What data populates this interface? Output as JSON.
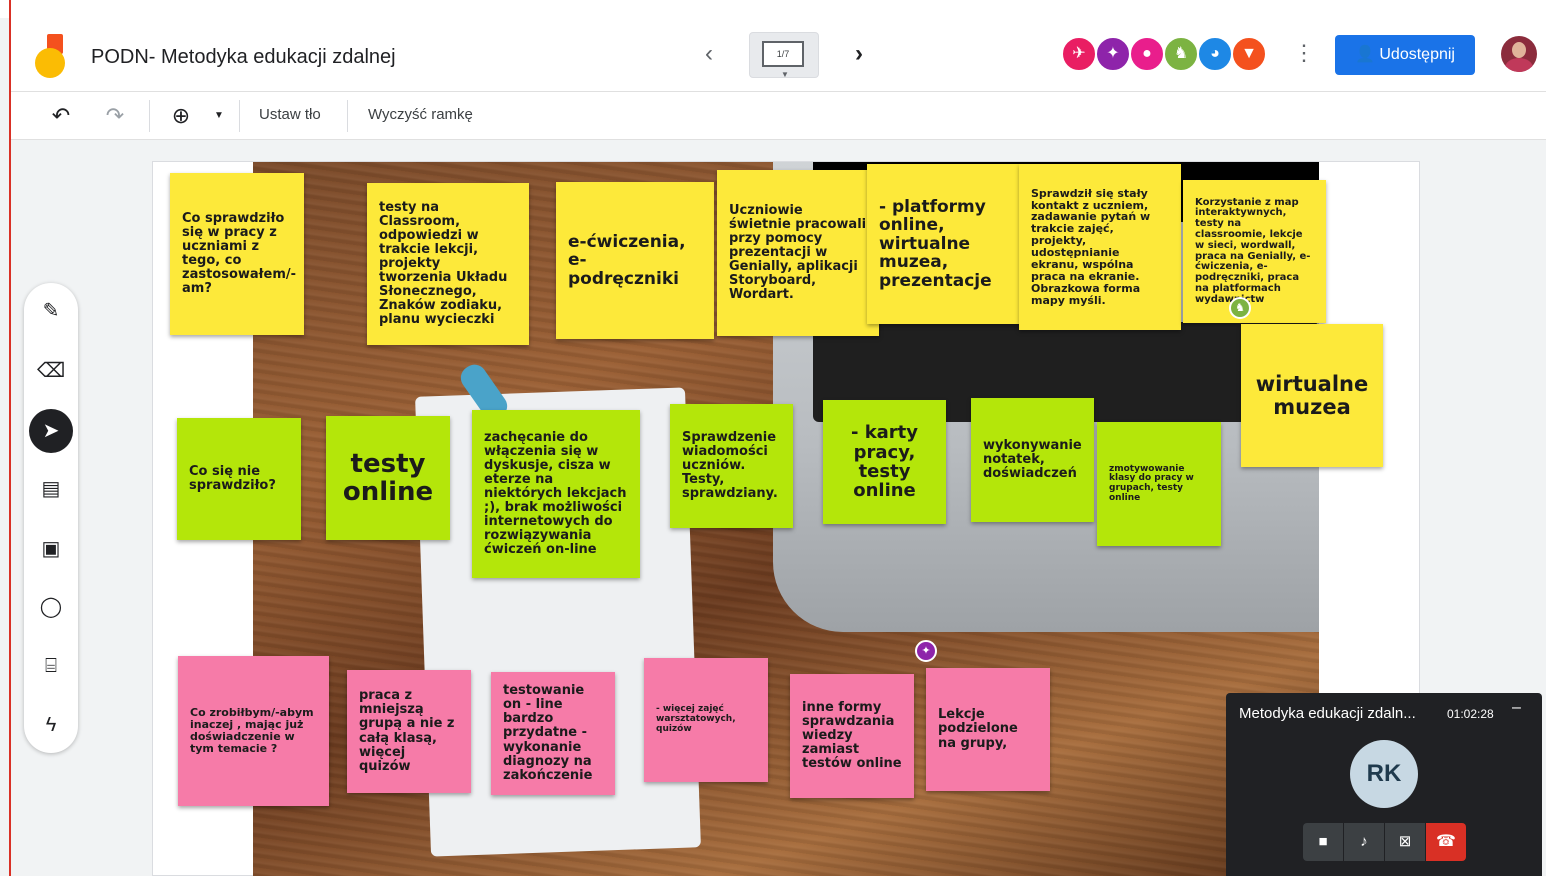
{
  "header": {
    "title": "PODN- Metodyka edukacji zdalnej",
    "frame_indicator": "1/7",
    "share_label": "Udostępnij"
  },
  "toolbar": {
    "set_background": "Ustaw tło",
    "clear_frame": "Wyczyść ramkę"
  },
  "notes": {
    "row1": [
      {
        "text": "Co sprawdziło się w pracy z uczniami z tego, co zastosowałem/-am?"
      },
      {
        "text": "testy na Classroom, odpowiedzi w trakcie lekcji, projekty tworzenia Układu Słonecznego, Znaków zodiaku, planu wycieczki"
      },
      {
        "text": "e-ćwiczenia, e- podręczniki"
      },
      {
        "text": "Uczniowie świetnie pracowali przy pomocy prezentacji w Genially, aplikacji Storyboard, Wordart."
      },
      {
        "text": "- platformy online, wirtualne muzea, prezentacje"
      },
      {
        "text": "Sprawdził się stały kontakt z uczniem, zadawanie pytań w trakcie zajęć, projekty, udostępnianie ekranu, wspólna praca na ekranie. Obrazkowa forma mapy myśli."
      },
      {
        "text": "Korzystanie z map interaktywnych, testy na classroomie, lekcje w sieci, wordwall, praca na Genially, e-ćwiczenia, e-podręczniki, praca na platformach wydawnictw"
      },
      {
        "text": "wirtualne muzea"
      }
    ],
    "row2": [
      {
        "text": "Co się nie sprawdziło?"
      },
      {
        "text": "testy online"
      },
      {
        "text": "zachęcanie do włączenia się w dyskusje, cisza w eterze na niektórych lekcjach ;), brak możliwości internetowych do rozwiązywania ćwiczeń on-line"
      },
      {
        "text": "Sprawdzenie wiadomości uczniów. Testy, sprawdziany."
      },
      {
        "text": "- karty pracy, testy online"
      },
      {
        "text": "wykonywanie notatek, doświadczeń"
      },
      {
        "text": "zmotywowanie klasy do pracy w grupach, testy online"
      }
    ],
    "row3": [
      {
        "text": "Co zrobiłbym/-abym inaczej , mając już doświadczenie w tym temacie ?"
      },
      {
        "text": "praca z mniejszą grupą a nie z całą klasą, więcej quizów"
      },
      {
        "text": "testowanie on - line bardzo przydatne - wykonanie diagnozy na zakończenie"
      },
      {
        "text": "- więcej zajęć warsztatowych, quizów"
      },
      {
        "text": "inne formy sprawdzania wiedzy zamiast testów online"
      },
      {
        "text": "Lekcje podzielone na grupy,"
      }
    ]
  },
  "meet": {
    "title": "Metodyka edukacji zdaln...",
    "time": "01:02:28",
    "initials": "RK"
  },
  "colors": {
    "yellow": "#fde93a",
    "green": "#b4e60a",
    "pink": "#f67ba8",
    "share_blue": "#1a73e8",
    "hangup_red": "#d93025"
  }
}
